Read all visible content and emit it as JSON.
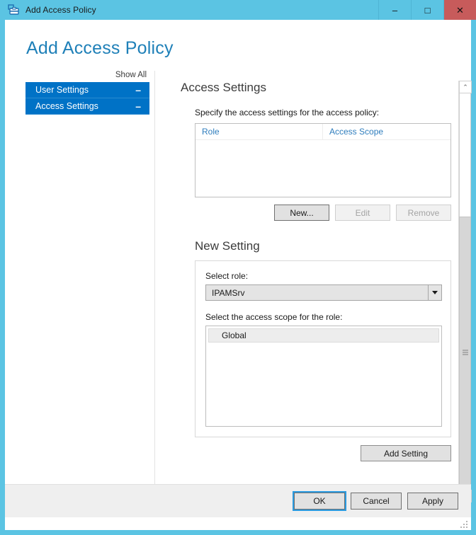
{
  "window": {
    "title": "Add Access Policy",
    "icon": "policy-toolbox-icon",
    "accent_color": "#5BC4E3",
    "close_color": "#C75B5B",
    "buttons": {
      "minimize": "–",
      "maximize": "□",
      "close": "✕"
    }
  },
  "page": {
    "title": "Add Access Policy",
    "title_color": "#1F80B8"
  },
  "nav": {
    "show_all": "Show All",
    "item_color": "#0072C6",
    "items": [
      {
        "label": "User Settings",
        "collapse": "–"
      },
      {
        "label": "Access Settings",
        "collapse": "–"
      }
    ]
  },
  "main": {
    "section_title": "Access Settings",
    "hint": "Specify the access settings for the access policy:",
    "listview": {
      "columns": [
        "Role",
        "Access Scope"
      ],
      "rows": []
    },
    "list_buttons": [
      {
        "label": "New...",
        "state": "default"
      },
      {
        "label": "Edit",
        "state": "disabled"
      },
      {
        "label": "Remove",
        "state": "disabled"
      }
    ],
    "new_setting": {
      "title": "New Setting",
      "role_label": "Select role:",
      "role_value": "IPAMSrv",
      "role_options": [
        "IPAMSrv"
      ],
      "scope_label": "Select the access scope for the role:",
      "scope_items": [
        "Global"
      ]
    },
    "add_setting_label": "Add Setting"
  },
  "scrollbar": {
    "up_arrow": "⌃",
    "down_arrow": "⌄"
  },
  "footer": {
    "buttons": [
      {
        "label": "OK",
        "state": "focused"
      },
      {
        "label": "Cancel",
        "state": "normal"
      },
      {
        "label": "Apply",
        "state": "normal"
      }
    ]
  }
}
